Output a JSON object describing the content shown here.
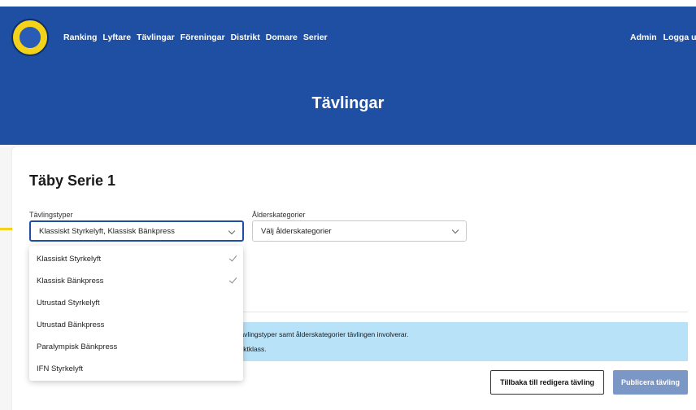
{
  "nav": {
    "links": [
      "Ranking",
      "Lyftare",
      "Tävlingar",
      "Föreningar",
      "Distrikt",
      "Domare",
      "Serier"
    ],
    "admin": "Admin",
    "logout": "Logga ut"
  },
  "page": {
    "heading": "Tävlingar"
  },
  "competition": {
    "title": "Täby Serie 1"
  },
  "form": {
    "types_label": "Tävlingstyper",
    "types_value": "Klassiskt Styrkelyft, Klassisk Bänkpress",
    "age_label": "Ålderskategorier",
    "age_placeholder": "Välj ålderskategorier"
  },
  "dropdown": {
    "options": [
      {
        "label": "Klassiskt Styrkelyft",
        "selected": true
      },
      {
        "label": "Klassisk Bänkpress",
        "selected": true
      },
      {
        "label": "Utrustad Styrkelyft",
        "selected": false
      },
      {
        "label": "Utrustad Bänkpress",
        "selected": false
      },
      {
        "label": "Paralympisk Bänkpress",
        "selected": false
      },
      {
        "label": "IFN Styrkelyft",
        "selected": false
      }
    ]
  },
  "info": {
    "line1": "a tävlingstyper samt ålderskategorier tävlingen involverar.",
    "line2": "h viktklass."
  },
  "buttons": {
    "back": "Tillbaka till redigera tävling",
    "publish": "Publicera tävling"
  },
  "colors": {
    "primary": "#1e4fa3",
    "accent": "#f5d21a",
    "info_bg": "#b8e2f8",
    "publish_disabled": "#7b97c6"
  }
}
